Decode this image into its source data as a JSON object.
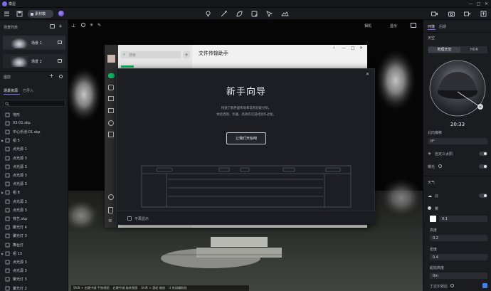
{
  "app": {
    "title": "模型",
    "accent": "#7c6cf0"
  },
  "toolbar": {
    "mode_label": "素材模"
  },
  "left_panel": {
    "scene_list_title": "场景列表",
    "scenes": [
      {
        "label": "场景 1"
      },
      {
        "label": "场景 2"
      }
    ],
    "layers_title": "图层",
    "tabs": [
      "场景资源",
      "已导入"
    ],
    "tree": [
      {
        "label": "地形",
        "caret": ""
      },
      {
        "label": "03-01.skp",
        "caret": ""
      },
      {
        "label": "中心乐池-01.skp",
        "caret": ""
      },
      {
        "label": "组 5",
        "caret": "▶"
      },
      {
        "label": "点光源 1",
        "caret": ""
      },
      {
        "label": "点光源 3",
        "caret": ""
      },
      {
        "label": "点光源 3",
        "caret": ""
      },
      {
        "label": "点光源 3",
        "caret": ""
      },
      {
        "label": "点光源 3",
        "caret": ""
      },
      {
        "label": "组 8",
        "caret": "▶"
      },
      {
        "label": "点光源 3",
        "caret": ""
      },
      {
        "label": "点光源 3",
        "caret": ""
      },
      {
        "label": "铁艺.skp",
        "caret": ""
      },
      {
        "label": "聚光灯 4",
        "caret": ""
      },
      {
        "label": "聚光灯 3",
        "caret": ""
      },
      {
        "label": "舞台灯",
        "caret": ""
      },
      {
        "label": "组 13",
        "caret": "▶"
      },
      {
        "label": "点光源 3",
        "caret": ""
      },
      {
        "label": "点光源 3",
        "caret": ""
      },
      {
        "label": "聚光灯 3",
        "caret": ""
      },
      {
        "label": "聚光灯 2",
        "caret": ""
      }
    ]
  },
  "viewport": {
    "camera_label": "相机",
    "display_label": "显示",
    "status": [
      "Shift + 右键中键 平移视图",
      "右键中键 旋转视图",
      "Shift + 滚轮 缩放",
      "U 关闭辅助线"
    ]
  },
  "chat_window": {
    "title": "文件传输助手",
    "search_placeholder": "搜索"
  },
  "guide": {
    "title": "新手向导",
    "subtitle_line1": "快速了解界面布局和常用功能分布。",
    "subtitle_line2": "体验直观、优雅、高效的沉浸式创作过程。",
    "button": "让我们开始吧",
    "footer_checkbox": "不再显示"
  },
  "right_panel": {
    "tabs": [
      "环境",
      "后期"
    ],
    "sky_title": "天空",
    "sky_tabs": [
      "地理天空",
      "HDR"
    ],
    "time": "20:33",
    "north_label": "北向偏移",
    "north_value": "0°",
    "custom_sun_label": "自定义太阳",
    "exposure_label": "曝光",
    "weather_title": "天气",
    "cloud_label": "云",
    "fog_label": "雾",
    "fog_value": "0.1",
    "height_label": "高度",
    "height_value": "0.2",
    "density_label": "密度",
    "density_value": "0.4",
    "start_height_label": "起始高度",
    "start_height_value": "0m",
    "fog_light_label": "丁达尔效应"
  }
}
